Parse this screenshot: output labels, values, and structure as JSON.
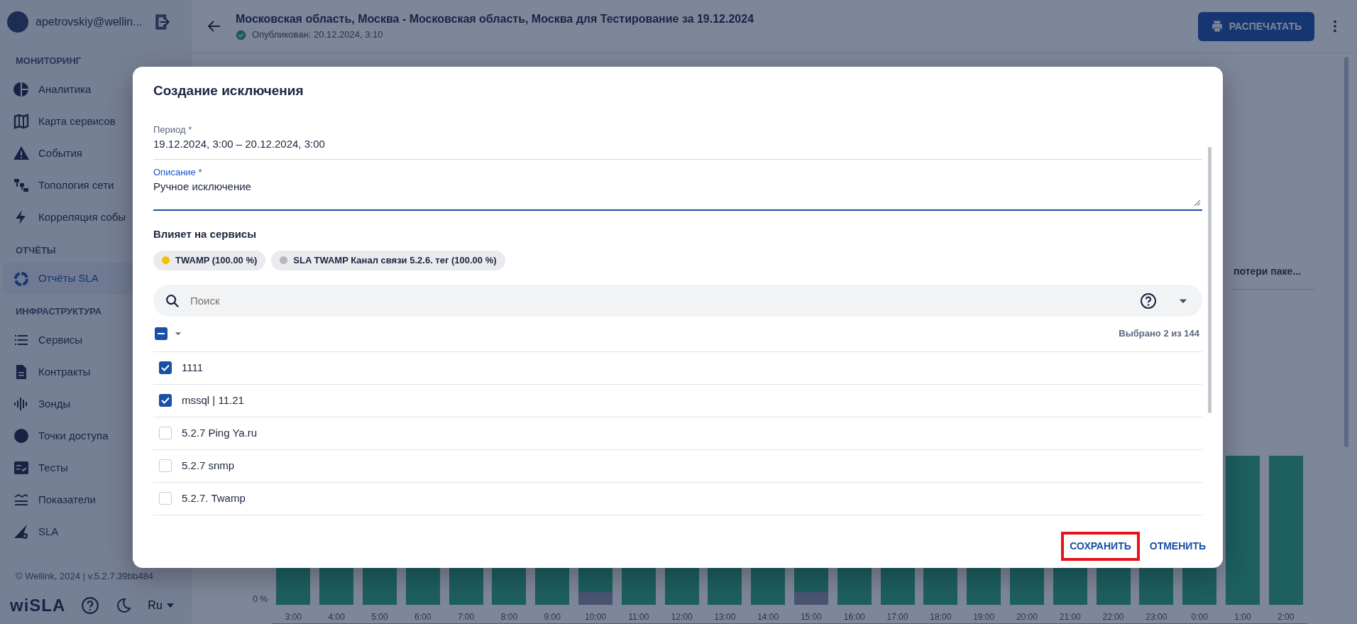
{
  "sidebar": {
    "user": "apetrovskiy@wellin...",
    "sections": [
      {
        "title": "МОНИТОРИНГ",
        "items": [
          {
            "label": "Аналитика",
            "selected": false
          },
          {
            "label": "Карта сервисов",
            "selected": false
          },
          {
            "label": "События",
            "selected": false
          },
          {
            "label": "Топология сети",
            "selected": false
          },
          {
            "label": "Корреляция собы",
            "selected": false
          }
        ]
      },
      {
        "title": "ОТЧЁТЫ",
        "items": [
          {
            "label": "Отчёты SLA",
            "selected": true
          }
        ]
      },
      {
        "title": "ИНФРАСТРУКТУРА",
        "items": [
          {
            "label": "Сервисы",
            "selected": false
          },
          {
            "label": "Контракты",
            "selected": false
          },
          {
            "label": "Зонды",
            "selected": false
          },
          {
            "label": "Точки доступа",
            "selected": false
          },
          {
            "label": "Тесты",
            "selected": false
          },
          {
            "label": "Показатели",
            "selected": false
          },
          {
            "label": "SLA",
            "selected": false
          }
        ]
      }
    ],
    "footer": "© Wellink, 2024 | v.5.2.7.39bb484",
    "logo": "wiSLA",
    "language": "Ru"
  },
  "header": {
    "title": "Московская область, Москва - Московская область, Москва для Тестирование за 19.12.2024",
    "status": "Опубликован: 20.12.2024, 3:10",
    "print_button": "РАСПЕЧАТАТЬ"
  },
  "background": {
    "column_header": "потери паке...",
    "y_label": "0 %",
    "bars": [
      {
        "label": "3:00",
        "gap": false
      },
      {
        "label": "4:00",
        "gap": false
      },
      {
        "label": "5:00",
        "gap": false
      },
      {
        "label": "6:00",
        "gap": false
      },
      {
        "label": "7:00",
        "gap": false
      },
      {
        "label": "8:00",
        "gap": false
      },
      {
        "label": "9:00",
        "gap": false
      },
      {
        "label": "10:00",
        "gap": true
      },
      {
        "label": "11:00",
        "gap": false
      },
      {
        "label": "12:00",
        "gap": false
      },
      {
        "label": "13:00",
        "gap": false
      },
      {
        "label": "14:00",
        "gap": false
      },
      {
        "label": "15:00",
        "gap": true
      },
      {
        "label": "16:00",
        "gap": false
      },
      {
        "label": "17:00",
        "gap": false
      },
      {
        "label": "18:00",
        "gap": false
      },
      {
        "label": "19:00",
        "gap": false
      },
      {
        "label": "20:00",
        "gap": false
      },
      {
        "label": "21:00",
        "gap": false
      },
      {
        "label": "22:00",
        "gap": false
      },
      {
        "label": "23:00",
        "gap": false
      },
      {
        "label": "0:00",
        "gap": false
      },
      {
        "label": "1:00",
        "gap": false
      },
      {
        "label": "2:00",
        "gap": false
      }
    ]
  },
  "dialog": {
    "title": "Создание исключения",
    "fields": [
      {
        "label": "Период *",
        "value": "19.12.2024, 3:00 – 20.12.2024, 3:00",
        "focused": false
      },
      {
        "label": "Описание *",
        "value": "Ручное исключение",
        "focused": true
      }
    ],
    "services_heading": "Влияет на сервисы",
    "chips": [
      {
        "label": "TWAMP (100.00 %)",
        "color": "#f5c000"
      },
      {
        "label": "SLA TWAMP Канал связи 5.2.6. тег (100.00 %)",
        "color": "#b8b8b8"
      }
    ],
    "search": {
      "placeholder": "Поиск"
    },
    "bulk": {
      "indeterminate": true
    },
    "summary": "Выбрано 2 из 144",
    "rows": [
      {
        "label": "1111",
        "checked": true
      },
      {
        "label": "mssql | 11.21",
        "checked": true
      },
      {
        "label": "5.2.7 Ping Ya.ru",
        "checked": false
      },
      {
        "label": "5.2.7 snmp",
        "checked": false
      },
      {
        "label": "5.2.7. Twamp",
        "checked": false
      }
    ],
    "buttons": [
      {
        "label": "СОХРАНИТЬ",
        "highlighted": true
      },
      {
        "label": "ОТМЕНИТЬ",
        "highlighted": false
      }
    ]
  }
}
